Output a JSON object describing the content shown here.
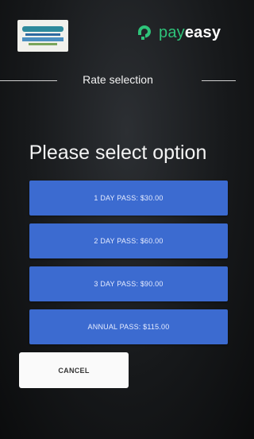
{
  "header": {
    "brand_light": "pay",
    "brand_bold": "easy",
    "brand_color": "#2ec47a",
    "partner_logo_icon": "partner-logo"
  },
  "section_title": "Rate selection",
  "prompt": "Please select option",
  "options": [
    {
      "label": "1 DAY PASS: $30.00"
    },
    {
      "label": "2 DAY PASS: $60.00"
    },
    {
      "label": "3 DAY PASS: $90.00"
    },
    {
      "label": "ANNUAL PASS: $115.00"
    }
  ],
  "cancel_label": "CANCEL",
  "colors": {
    "option_button": "#3c6bd0",
    "cancel_button": "#fafafa",
    "background": "#17191b"
  }
}
